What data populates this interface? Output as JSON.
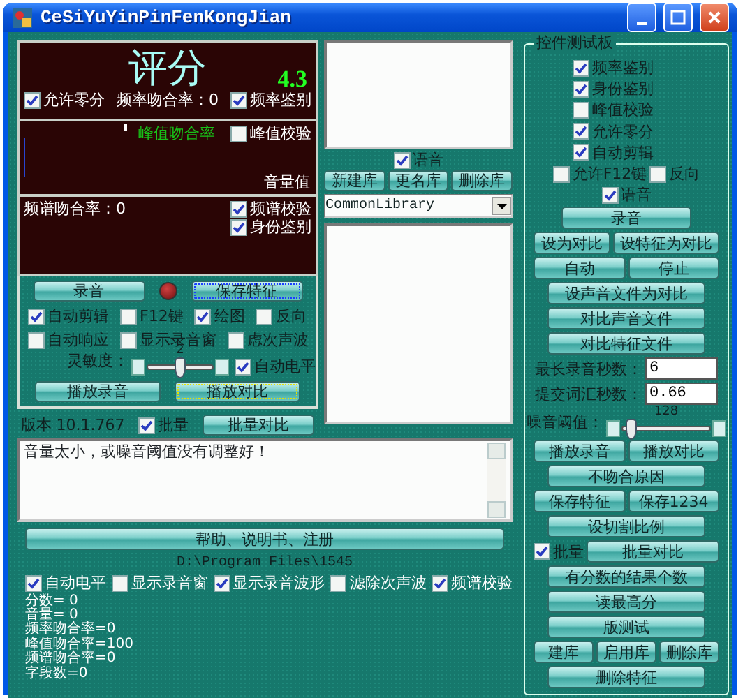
{
  "window": {
    "title": "CeSiYuYinPinFenKongJian"
  },
  "score_panel": {
    "title": "评分",
    "score": "4.3",
    "items": [
      {
        "kind": "check",
        "label": "允许零分",
        "checked": true
      },
      {
        "kind": "text",
        "label": "频率吻合率：0"
      },
      {
        "kind": "check",
        "label": "频率鉴别",
        "checked": true
      }
    ]
  },
  "peak_panel": {
    "label": "峰值吻合率",
    "check": {
      "label": "峰值校验",
      "checked": false
    },
    "volume_label": "音量值"
  },
  "spectrum_panel": {
    "rate": "频谱吻合率：0",
    "checks": [
      {
        "label": "频谱校验",
        "checked": true
      },
      {
        "label": "身份鉴别",
        "checked": true
      }
    ]
  },
  "control_panel": {
    "record_row": [
      {
        "kind": "button",
        "label": "录音",
        "focused": false
      },
      {
        "kind": "led",
        "on": true
      },
      {
        "kind": "button",
        "label": "保存特征",
        "focused": true
      }
    ],
    "option_checks": [
      {
        "label": "自动剪辑",
        "checked": true
      },
      {
        "label": "F12键",
        "checked": false
      },
      {
        "label": "绘图",
        "checked": true
      },
      {
        "label": "反向",
        "checked": false
      }
    ],
    "more_checks": [
      {
        "label": "自动响应",
        "checked": false
      },
      {
        "label": "显示录音窗",
        "checked": false
      },
      {
        "label": "虑次声波",
        "checked": false
      }
    ],
    "sensitivity": {
      "label": "灵敏度：",
      "value": "2",
      "level": 0.5
    },
    "auto_level": {
      "label": "自动电平",
      "checked": true
    },
    "play_buttons": [
      {
        "label": "播放录音",
        "focused": false
      },
      {
        "label": "播放对比",
        "focused": true
      }
    ]
  },
  "version": {
    "items": [
      {
        "kind": "text",
        "label": "版本 10.1.767"
      },
      {
        "kind": "check",
        "label": "批量",
        "checked": true
      },
      {
        "kind": "button",
        "label": "批量对比",
        "focused": false
      }
    ]
  },
  "library": {
    "check": {
      "label": "语音",
      "checked": true
    },
    "buttons": [
      "新建库",
      "更名库",
      "删除库"
    ],
    "select": "CommonLibrary"
  },
  "message": "音量太小，或噪音阈值没有调整好！",
  "help_button": "帮助、说明书、注册",
  "path": "D:\\Program Files\\1545",
  "options": [
    {
      "label": "自动电平",
      "checked": true
    },
    {
      "label": "显示录音窗",
      "checked": false
    },
    {
      "label": "显示录音波形",
      "checked": true
    },
    {
      "label": "滤除次声波",
      "checked": false
    },
    {
      "label": "频谱校验",
      "checked": true
    }
  ],
  "stats": [
    "分数= 0",
    "音量= 0",
    "频率吻合率=0",
    "峰值吻合率=100",
    "频谱吻合率=0",
    "字段数=0"
  ],
  "test_panel": {
    "title": "控件测试板",
    "rows": [
      [
        {
          "kind": "check",
          "label": "频率鉴别",
          "checked": true
        }
      ],
      [
        {
          "kind": "check",
          "label": "身份鉴别",
          "checked": true
        }
      ],
      [
        {
          "kind": "check",
          "label": "峰值校验",
          "checked": false
        }
      ],
      [
        {
          "kind": "check",
          "label": "允许零分",
          "checked": true
        }
      ],
      [
        {
          "kind": "check",
          "label": "自动剪辑",
          "checked": true
        }
      ],
      [
        {
          "kind": "check",
          "label": "允许F12键",
          "checked": false
        },
        {
          "kind": "check",
          "label": "反向",
          "checked": false
        }
      ],
      [
        {
          "kind": "check",
          "label": "语音",
          "checked": true
        }
      ],
      [
        {
          "kind": "button",
          "label": "录音",
          "focused": false
        }
      ],
      [
        {
          "kind": "button",
          "label": "设为对比",
          "focused": false
        },
        {
          "kind": "button",
          "label": "设特征为对比",
          "focused": false
        }
      ],
      [
        {
          "kind": "button",
          "label": "自动",
          "focused": false
        },
        {
          "kind": "button",
          "label": "停止",
          "focused": false
        }
      ],
      [
        {
          "kind": "button",
          "label": "设声音文件为对比",
          "focused": false
        }
      ],
      [
        {
          "kind": "button",
          "label": "对比声音文件",
          "focused": false
        }
      ],
      [
        {
          "kind": "button",
          "label": "对比特征文件",
          "focused": false
        }
      ],
      [
        {
          "kind": "field",
          "label": "最长录音秒数：",
          "value": "6"
        }
      ],
      [
        {
          "kind": "field",
          "label": "提交词汇秒数：",
          "value": "0.66"
        }
      ],
      [
        {
          "kind": "slider",
          "label": "噪音阈值：",
          "value": "128",
          "level": 0.05
        }
      ],
      [
        {
          "kind": "button",
          "label": "播放录音",
          "focused": false
        },
        {
          "kind": "button",
          "label": "播放对比",
          "focused": false
        }
      ],
      [
        {
          "kind": "button",
          "label": "不吻合原因",
          "focused": false
        }
      ],
      [
        {
          "kind": "button",
          "label": "保存特征",
          "focused": false
        },
        {
          "kind": "button",
          "label": "保存1234",
          "focused": false
        }
      ],
      [
        {
          "kind": "button",
          "label": "设切割比例",
          "focused": false
        }
      ],
      [
        {
          "kind": "check",
          "label": "批量",
          "checked": true
        },
        {
          "kind": "button",
          "label": "批量对比",
          "focused": false
        }
      ],
      [
        {
          "kind": "button",
          "label": "有分数的结果个数",
          "focused": false
        }
      ],
      [
        {
          "kind": "button",
          "label": "读最高分",
          "focused": false
        }
      ],
      [
        {
          "kind": "button",
          "label": "版测试",
          "focused": false
        }
      ],
      [
        {
          "kind": "button",
          "label": "建库",
          "focused": false
        },
        {
          "kind": "button",
          "label": "启用库",
          "focused": false
        },
        {
          "kind": "button",
          "label": "删除库",
          "focused": false
        }
      ],
      [
        {
          "kind": "button",
          "label": "删除特征",
          "focused": false
        }
      ]
    ]
  }
}
